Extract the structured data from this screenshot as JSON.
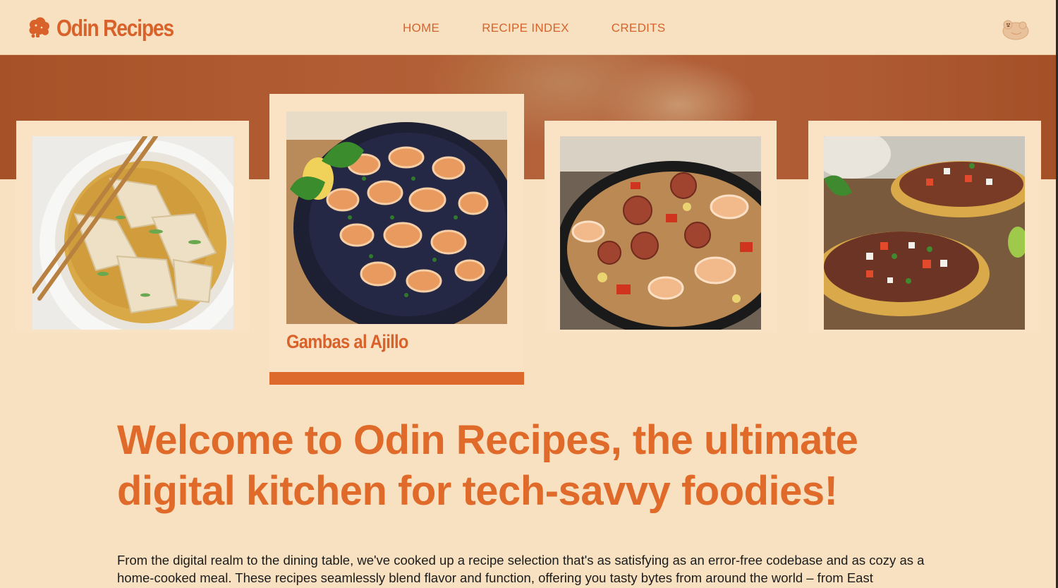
{
  "header": {
    "logo_text": "Odin Recipes",
    "nav": {
      "home": "HOME",
      "recipe_index": "RECIPE INDEX",
      "credits": "CREDITS"
    }
  },
  "carousel": {
    "cards": [
      {
        "image": "wonton-soup-photo",
        "title": ""
      },
      {
        "image": "garlic-shrimp-photo",
        "title": "Gambas al Ajillo"
      },
      {
        "image": "jambalaya-skillet-photo",
        "title": ""
      },
      {
        "image": "tostadas-photo",
        "title": ""
      }
    ],
    "active_index": 1
  },
  "main": {
    "welcome_heading": "Welcome to Odin Recipes, the ultimate digital kitchen for tech-savvy foodies!",
    "intro_text": "From the digital realm to the dining table, we've cooked up a recipe selection that's as satisfying as an error-free codebase and as cozy as a home-cooked meal. These recipes seamlessly blend flavor and function, offering you tasty bytes from around the world – from East"
  },
  "colors": {
    "background": "#f8e1c1",
    "accent": "#d9622b",
    "hero_band": "#b3623a"
  },
  "icons": [
    "cloud-logo-icon",
    "otter-icon"
  ]
}
